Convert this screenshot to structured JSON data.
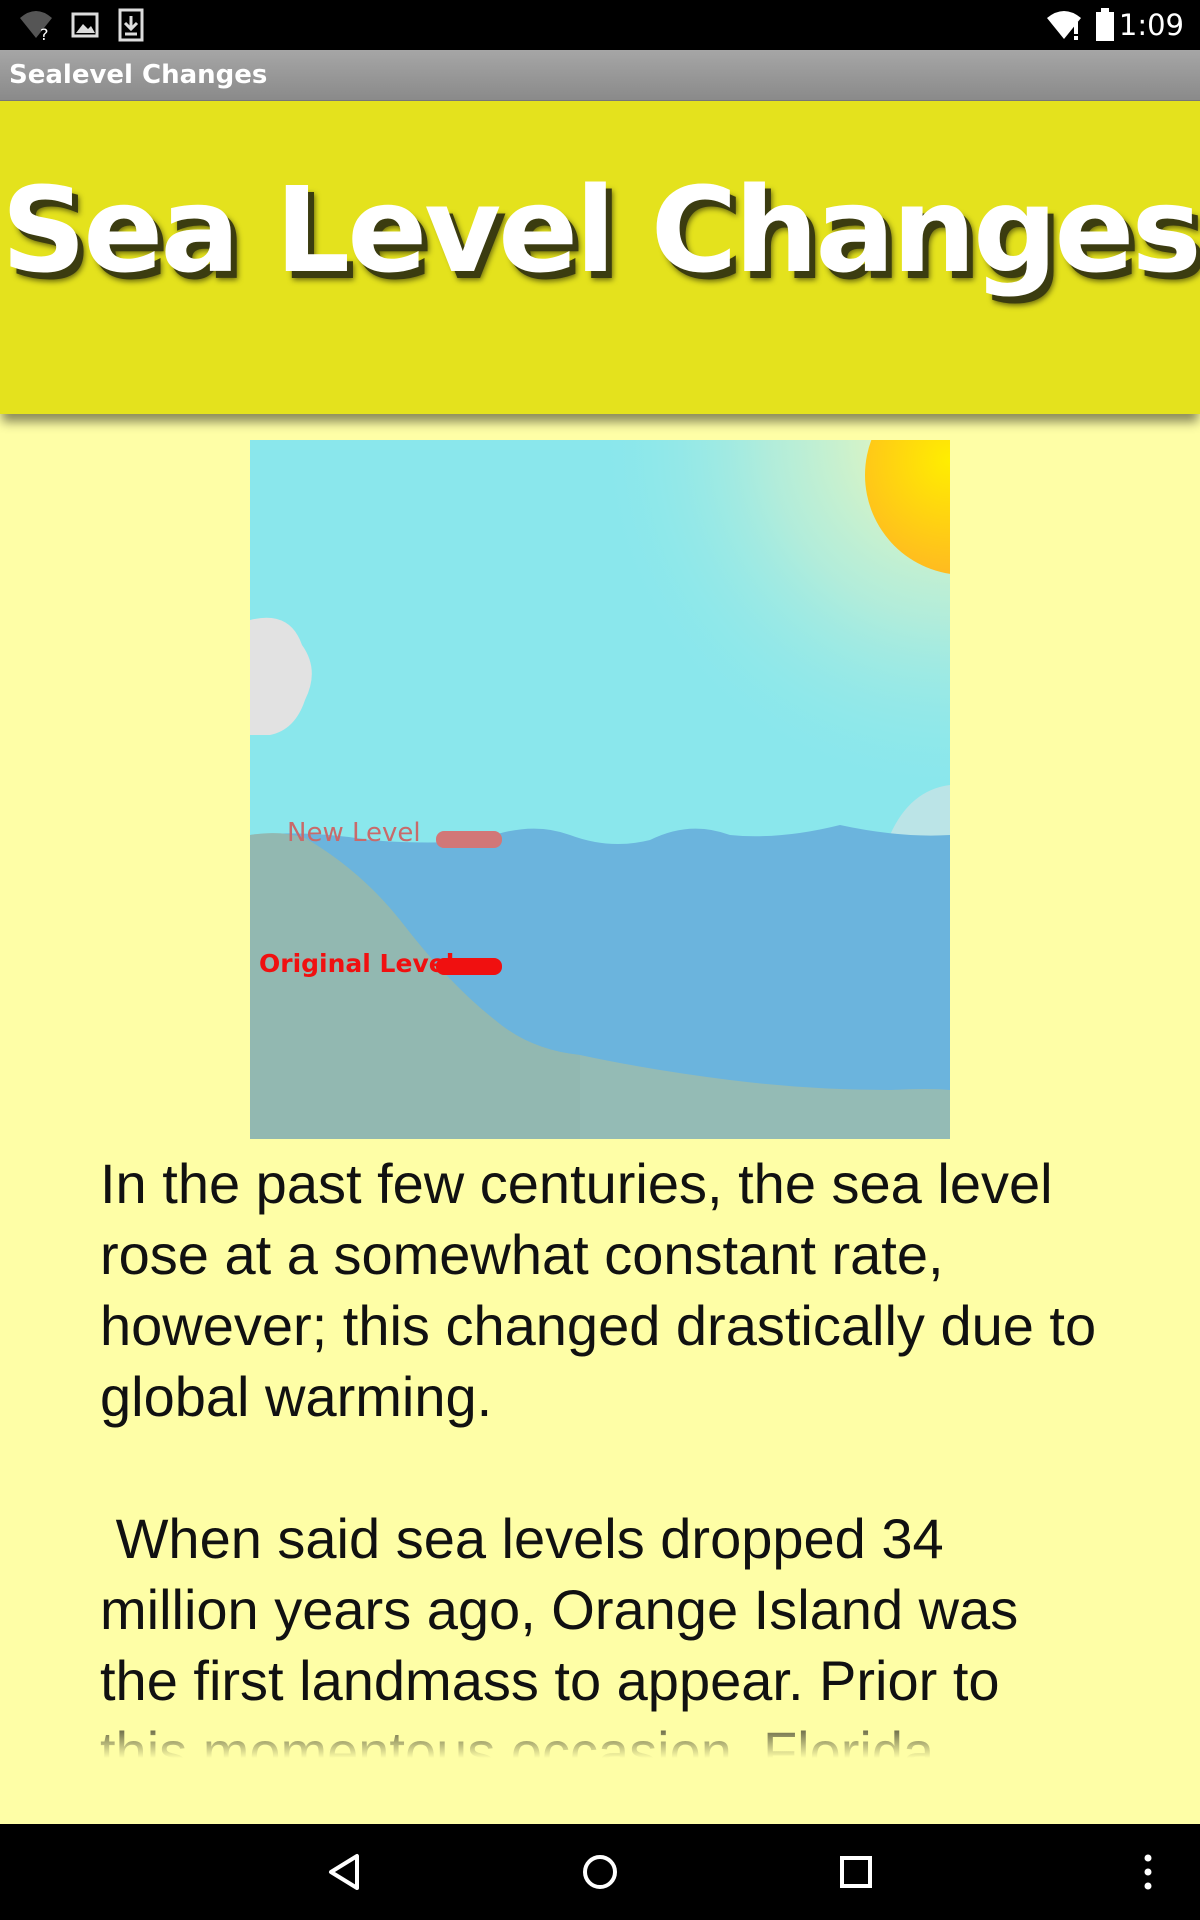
{
  "status_bar": {
    "time": "1:09",
    "icons": [
      "wifi-question-icon",
      "image-icon",
      "download-icon",
      "wifi-alert-icon",
      "battery-icon"
    ]
  },
  "action_bar": {
    "title": "Sealevel Changes"
  },
  "banner": {
    "heading": "Sea Level Changes",
    "background_color": "#e4e21d"
  },
  "illustration": {
    "new_level_label": "New Level",
    "original_level_label": "Original Level",
    "sky_color": "#8ae7ec",
    "water_color": "#6bb4dd",
    "land_color": "#94bbb5",
    "sun_color": "#ffd11a",
    "new_level_marker_color": "#d27777",
    "original_level_marker_color": "#f01010"
  },
  "content": {
    "paragraphs": [
      "In the past few centuries, the sea level rose at a somewhat constant rate, however; this changed drastically due to global warming.",
      " When said sea levels dropped 34 million years ago, Orange Island was the first landmass to appear. Prior to this momentous occasion, Florida"
    ]
  },
  "nav_bar": {
    "buttons": [
      "back-icon",
      "home-icon",
      "recents-icon",
      "overflow-menu-icon"
    ]
  },
  "colors": {
    "page_background": "#fefea6",
    "status_bar": "#000000",
    "action_bar": "#999999"
  }
}
